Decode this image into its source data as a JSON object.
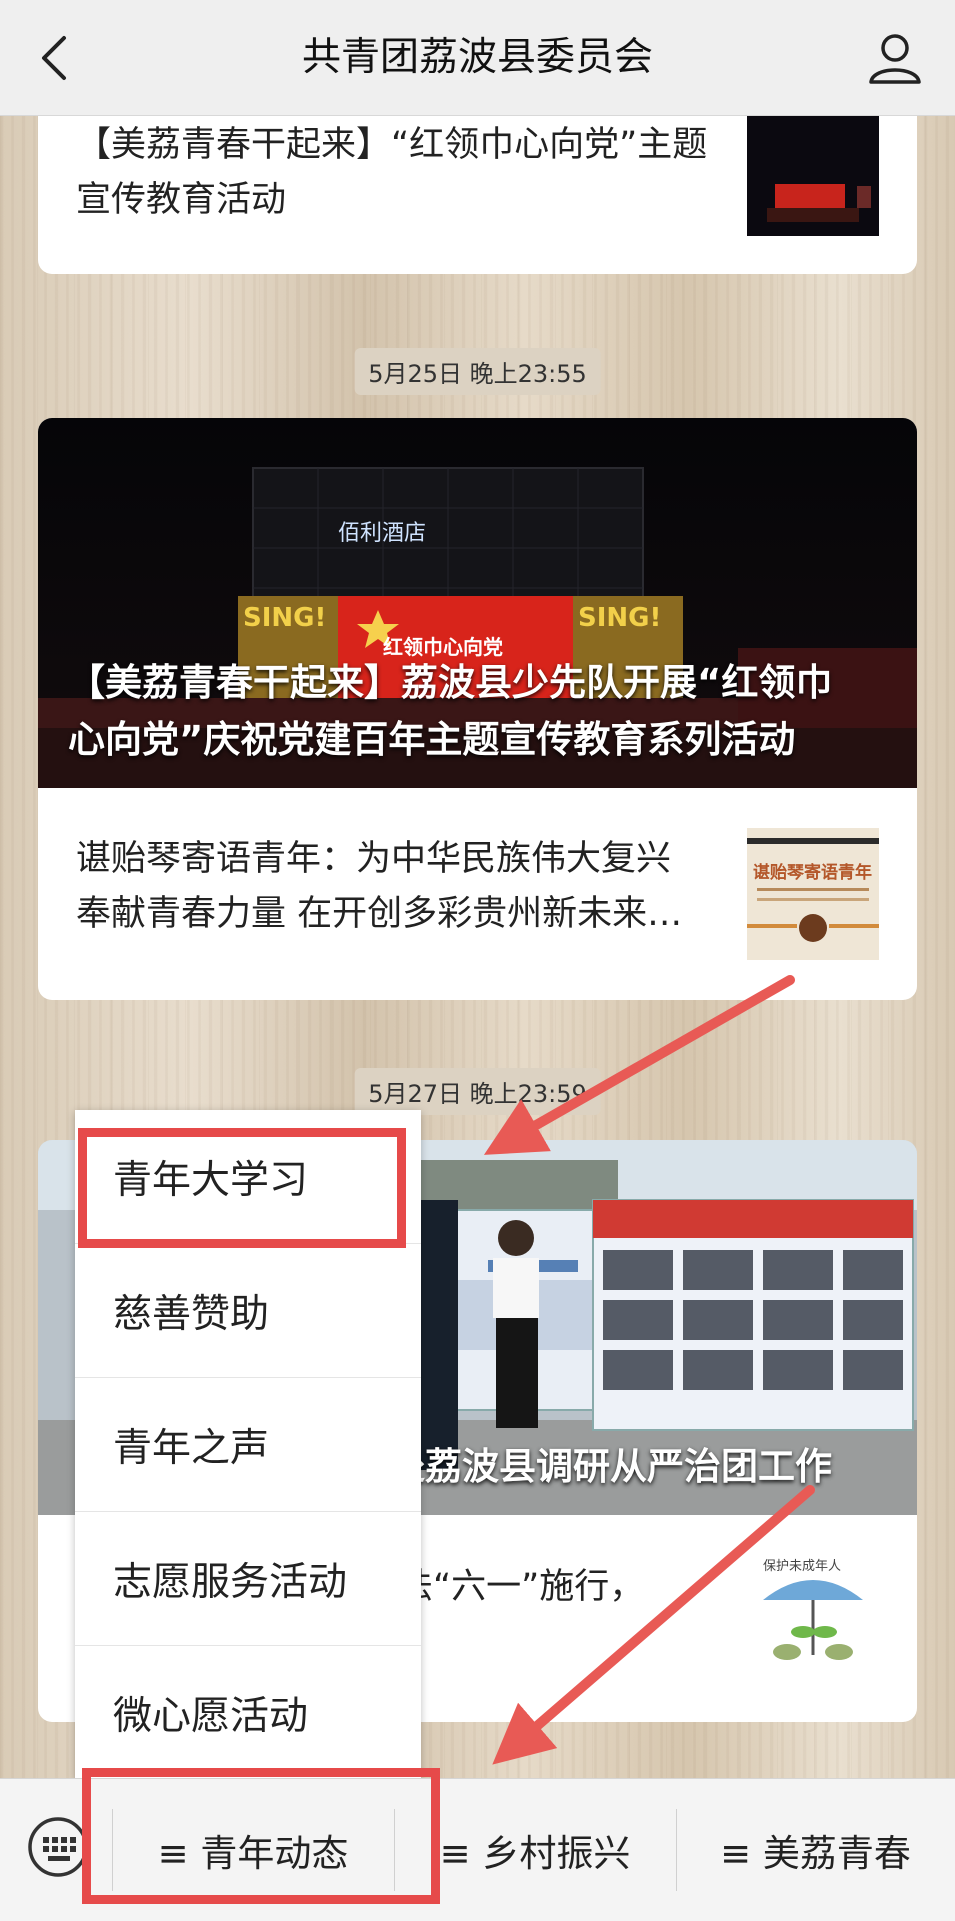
{
  "header": {
    "title": "共青团荔波县委员会",
    "back_icon": "chevron-left-icon",
    "profile_icon": "user-icon"
  },
  "card_top": {
    "text_line1": "【美荔青春干起来】“红领巾心向党”主题",
    "text_line2": "宣传教育活动"
  },
  "ts1": "5月25日 晚上23:55",
  "card_main": {
    "hero_caption_line1": "【美荔青春干起来】荔波县少先队开展“红领巾",
    "hero_caption_line2": "心向党”庆祝党建百年主题宣传教育系列活动",
    "hero_sign": "红领巾心向党",
    "hero_hotel": "佰利酒店",
    "hero_sing": "SING!",
    "row_line1": "谌贻琴寄语青年：为中华民族伟大复兴",
    "row_line2": "奉献青春力量 在开创多彩贵州新未来…",
    "thumb_text": "谌贻琴寄语青年"
  },
  "ts2": "5月27日 晚上23:59",
  "card_third": {
    "hero_caption": "赴荔波县调研从严治团工作",
    "row_text": "法“六一”施行，",
    "thumb_text": "保护未成年人"
  },
  "submenu": {
    "items": [
      "青年大学习",
      "慈善赞助",
      "青年之声",
      "志愿服务活动",
      "微心愿活动"
    ]
  },
  "bottom_menu": {
    "keyboard_icon": "keyboard-icon",
    "items": [
      "≡ 青年动态",
      "≡ 乡村振兴",
      "≡ 美荔青春"
    ]
  },
  "colors": {
    "highlight": "#e64a4a",
    "arrow": "#e85a55"
  }
}
